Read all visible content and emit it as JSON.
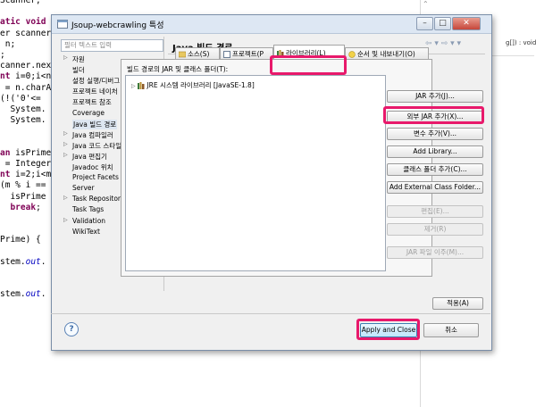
{
  "editor": {
    "lines": [
      {
        "parts": [
          [
            "Scanner;",
            ""
          ]
        ]
      },
      {
        "parts": [
          [
            "",
            ""
          ]
        ]
      },
      {
        "parts": [
          [
            "atic ",
            "kw"
          ],
          [
            "void",
            "kw"
          ]
        ]
      },
      {
        "parts": [
          [
            "er scanner",
            ""
          ]
        ]
      },
      {
        "parts": [
          [
            " n;",
            ""
          ]
        ]
      },
      {
        "parts": [
          [
            ";",
            ""
          ]
        ]
      },
      {
        "parts": [
          [
            "canner.nex",
            ""
          ]
        ]
      },
      {
        "parts": [
          [
            "nt ",
            "kw"
          ],
          [
            "i=0;i<n",
            ""
          ]
        ]
      },
      {
        "parts": [
          [
            " = n.charA",
            ""
          ]
        ]
      },
      {
        "parts": [
          [
            "(!('0'<=",
            ""
          ]
        ]
      },
      {
        "parts": [
          [
            "  System.",
            ""
          ]
        ]
      },
      {
        "parts": [
          [
            "  System.",
            ""
          ]
        ]
      },
      {
        "parts": [
          [
            "",
            ""
          ]
        ]
      },
      {
        "parts": [
          [
            "",
            ""
          ]
        ]
      },
      {
        "parts": [
          [
            "an ",
            "kw"
          ],
          [
            "isPrime",
            ""
          ]
        ]
      },
      {
        "parts": [
          [
            " = Integer",
            ""
          ]
        ]
      },
      {
        "parts": [
          [
            "nt ",
            "kw"
          ],
          [
            "i=2;i<m",
            ""
          ]
        ]
      },
      {
        "parts": [
          [
            "(m % i ==",
            ""
          ]
        ]
      },
      {
        "parts": [
          [
            "  isPrime",
            ""
          ]
        ]
      },
      {
        "parts": [
          [
            "  ",
            ""
          ],
          [
            "break",
            "kw"
          ],
          [
            ";",
            ""
          ]
        ]
      },
      {
        "parts": [
          [
            "",
            ""
          ]
        ]
      },
      {
        "parts": [
          [
            "",
            ""
          ]
        ]
      },
      {
        "parts": [
          [
            "Prime) {",
            ""
          ]
        ]
      },
      {
        "parts": [
          [
            "",
            ""
          ]
        ]
      },
      {
        "parts": [
          [
            "stem.",
            ""
          ],
          [
            "out",
            "fld"
          ],
          [
            ".",
            ""
          ]
        ]
      },
      {
        "parts": [
          [
            "",
            ""
          ]
        ]
      },
      {
        "parts": [
          [
            "",
            ""
          ]
        ]
      },
      {
        "parts": [
          [
            "stem.",
            ""
          ],
          [
            "out",
            "fld"
          ],
          [
            ".",
            ""
          ]
        ]
      }
    ],
    "right_panel_text": "g[]) : void"
  },
  "dialog": {
    "title": "Jsoup-webcrawling 특성",
    "filter_placeholder": "필터 텍스트 입력",
    "tree": [
      {
        "label": "자원",
        "expandable": true
      },
      {
        "label": "빌더",
        "expandable": false
      },
      {
        "label": "설정 실행/디버그",
        "expandable": false
      },
      {
        "label": "프로젝트 네이처",
        "expandable": false
      },
      {
        "label": "프로젝트 참조",
        "expandable": false
      },
      {
        "label": "Coverage",
        "expandable": false
      },
      {
        "label": "Java 빌드 경로",
        "expandable": false,
        "selected": true
      },
      {
        "label": "Java 컴파일러",
        "expandable": true
      },
      {
        "label": "Java 코드 스타일",
        "expandable": true
      },
      {
        "label": "Java 편집기",
        "expandable": true
      },
      {
        "label": "Javadoc 위치",
        "expandable": false
      },
      {
        "label": "Project Facets",
        "expandable": false
      },
      {
        "label": "Server",
        "expandable": false
      },
      {
        "label": "Task Repository",
        "expandable": true
      },
      {
        "label": "Task Tags",
        "expandable": false
      },
      {
        "label": "Validation",
        "expandable": true
      },
      {
        "label": "WikiText",
        "expandable": false
      }
    ],
    "page_title": "Java 빌드 경로",
    "nav_arrows": "⇦ ▾ ⇨ ▾ ▾",
    "tabs": [
      {
        "label": "소스(S)"
      },
      {
        "label": "프로젝트(P"
      },
      {
        "label": "라이브러리(L)"
      },
      {
        "label": "순서 및 내보내기(O)"
      }
    ],
    "list_label": "빌드 경로의 JAR 및 클래스 폴더(T):",
    "jar_entry": "JRE 시스템 라이브러리 [JavaSE-1.8]",
    "buttons": {
      "add_jar": "JAR 추가(J)...",
      "add_external_jar": "외부 JAR 추가(X)...",
      "add_variable": "변수 추가(V)...",
      "add_library": "Add Library...",
      "add_class_folder": "클래스 폴더 추가(C)...",
      "add_external_class_folder": "Add External Class Folder...",
      "edit": "편집(E)...",
      "remove": "제거(R)",
      "migrate_jar": "JAR 파일 이주(M)...",
      "apply": "적용(A)",
      "apply_and_close": "Apply and Close",
      "cancel": "취소"
    },
    "help_symbol": "?",
    "win_minimize": "–",
    "win_maximize": "□",
    "win_close": "✕"
  },
  "colors": {
    "highlight": "#e8196b",
    "keyword": "#7f0055",
    "field": "#0000c0"
  }
}
